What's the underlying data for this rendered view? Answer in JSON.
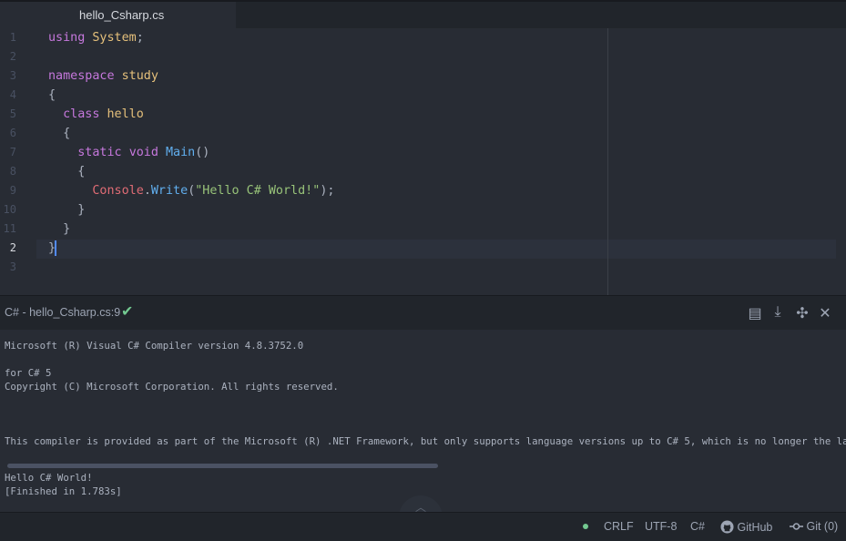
{
  "tab": {
    "title": "hello_Csharp.cs"
  },
  "editor": {
    "line_numbers": [
      "1",
      "2",
      "3",
      "4",
      "5",
      "6",
      "7",
      "8",
      "9",
      "10",
      "11",
      "2",
      "3"
    ],
    "lines": [
      [
        {
          "t": "using ",
          "c": "kw"
        },
        {
          "t": "System",
          "c": "ty"
        },
        {
          "t": ";",
          "c": ""
        }
      ],
      [],
      [
        {
          "t": "namespace ",
          "c": "kw"
        },
        {
          "t": "study",
          "c": "ty"
        }
      ],
      [
        {
          "t": "{",
          "c": ""
        }
      ],
      [
        {
          "t": "  class ",
          "c": "kw"
        },
        {
          "t": "hello",
          "c": "ty"
        }
      ],
      [
        {
          "t": "  {",
          "c": ""
        }
      ],
      [
        {
          "t": "    static ",
          "c": "kw"
        },
        {
          "t": "void ",
          "c": "kw"
        },
        {
          "t": "Main",
          "c": "fn"
        },
        {
          "t": "()",
          "c": ""
        }
      ],
      [
        {
          "t": "    {",
          "c": ""
        }
      ],
      [
        {
          "t": "      Console",
          "c": "obj"
        },
        {
          "t": ".",
          "c": ""
        },
        {
          "t": "Write",
          "c": "fn"
        },
        {
          "t": "(",
          "c": ""
        },
        {
          "t": "\"Hello C# World!\"",
          "c": "str"
        },
        {
          "t": ");",
          "c": ""
        }
      ],
      [
        {
          "t": "    }",
          "c": ""
        }
      ],
      [
        {
          "t": "  }",
          "c": ""
        }
      ],
      [
        {
          "t": "}",
          "c": ""
        }
      ],
      []
    ]
  },
  "panel": {
    "title": "C# - hello_Csharp.cs:9",
    "check_icon": "✔",
    "icons": {
      "file": "▤",
      "download": "⤓",
      "pin": "✣",
      "close": "✕"
    }
  },
  "output": {
    "lines": [
      "Microsoft (R) Visual C# Compiler version 4.8.3752.0",
      "for C# 5",
      "Copyright (C) Microsoft Corporation. All rights reserved.",
      "This compiler is provided as part of the Microsoft (R) .NET Framework, but only supports language versions up to C# 5, which is no longer the latest",
      "Hello C# World!",
      "[Finished in 1.783s]"
    ],
    "collapse_icon": "︿"
  },
  "status": {
    "line_ending": "CRLF",
    "encoding": "UTF-8",
    "grammar": "C#",
    "github": "GitHub",
    "git": "Git (0)",
    "status_color": "#73c990"
  }
}
